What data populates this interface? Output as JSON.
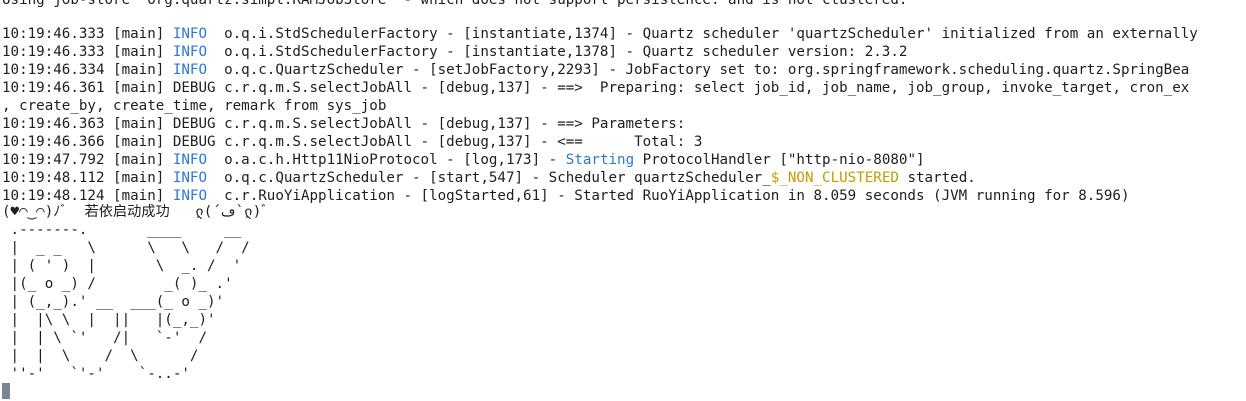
{
  "terminal": {
    "top_partial_line": "Using job-store 'org.quartz.simpl.RAMJobStore' - which does not support persistence. and is not clustered.",
    "log_lines": [
      {
        "ts": "10:19:46.333",
        "thread": "[main]",
        "level": "INFO ",
        "rest_before": " o.q.i.StdSchedulerFactory - [instantiate,1374] - Quartz scheduler 'quartzScheduler' initialized from an externally",
        "highlight": "",
        "rest_after": ""
      },
      {
        "ts": "10:19:46.333",
        "thread": "[main]",
        "level": "INFO ",
        "rest_before": " o.q.i.StdSchedulerFactory - [instantiate,1378] - Quartz scheduler version: 2.3.2",
        "highlight": "",
        "rest_after": ""
      },
      {
        "ts": "10:19:46.334",
        "thread": "[main]",
        "level": "INFO ",
        "rest_before": " o.q.c.QuartzScheduler - [setJobFactory,2293] - JobFactory set to: org.springframework.scheduling.quartz.SpringBea",
        "highlight": "",
        "rest_after": ""
      },
      {
        "ts": "10:19:46.361",
        "thread": "[main]",
        "level": "DEBUG",
        "rest_before": " c.r.q.m.S.selectJobAll - [debug,137] - ==>  Preparing: select job_id, job_name, job_group, invoke_target, cron_ex",
        "highlight": "",
        "rest_after": ""
      },
      {
        "ts": "",
        "thread": "",
        "level": "",
        "rest_before": ", create_by, create_time, remark from sys_job",
        "highlight": "",
        "rest_after": ""
      },
      {
        "ts": "10:19:46.363",
        "thread": "[main]",
        "level": "DEBUG",
        "rest_before": " c.r.q.m.S.selectJobAll - [debug,137] - ==> Parameters: ",
        "highlight": "",
        "rest_after": ""
      },
      {
        "ts": "10:19:46.366",
        "thread": "[main]",
        "level": "DEBUG",
        "rest_before": " c.r.q.m.S.selectJobAll - [debug,137] - <==      Total: 3",
        "highlight": "",
        "rest_after": ""
      },
      {
        "ts": "10:19:47.792",
        "thread": "[main]",
        "level": "INFO ",
        "rest_before": " o.a.c.h.Http11NioProtocol - [log,173] - ",
        "highlight": "Starting",
        "rest_after": " ProtocolHandler [\"http-nio-8080\"]"
      },
      {
        "ts": "10:19:48.112",
        "thread": "[main]",
        "level": "INFO ",
        "rest_before": " o.q.c.QuartzScheduler - [start,547] - Scheduler quartzScheduler_",
        "highlight": "$_NON_CLUSTERED",
        "rest_after": " started."
      },
      {
        "ts": "10:19:48.124",
        "thread": "[main]",
        "level": "INFO ",
        "rest_before": " c.r.RuoYiApplication - [logStarted,61] - Started RuoYiApplication in 8.059 seconds (JVM running for 8.596)",
        "highlight": "",
        "rest_after": ""
      }
    ],
    "success_line": "(♥◠‿◠)ﾉﾞ  若依启动成功   ლ(´ڡ`ლ)ﾞ",
    "ascii_art": [
      " .-------.       ____     __",
      " |  _ _   \\      \\   \\   /  /",
      " | ( ' )  |       \\  _. /  '",
      " |(_ o _) /        _( )_ .'",
      " | (_,_).' __  ___(_ o _)'",
      " |  |\\ \\  |  ||   |(_,_)'",
      " |  | \\ `'   /|   `-'  /",
      " |  |  \\    /  \\      /",
      " ''-'   `'-'    `-..-'"
    ],
    "colors": {
      "background": "#ffffff",
      "text": "#1e1e1e",
      "info": "#2a79d1",
      "highlight_blue": "#2a79d1",
      "highlight_yellow": "#c79a00",
      "cursor": "#7a8696"
    }
  }
}
